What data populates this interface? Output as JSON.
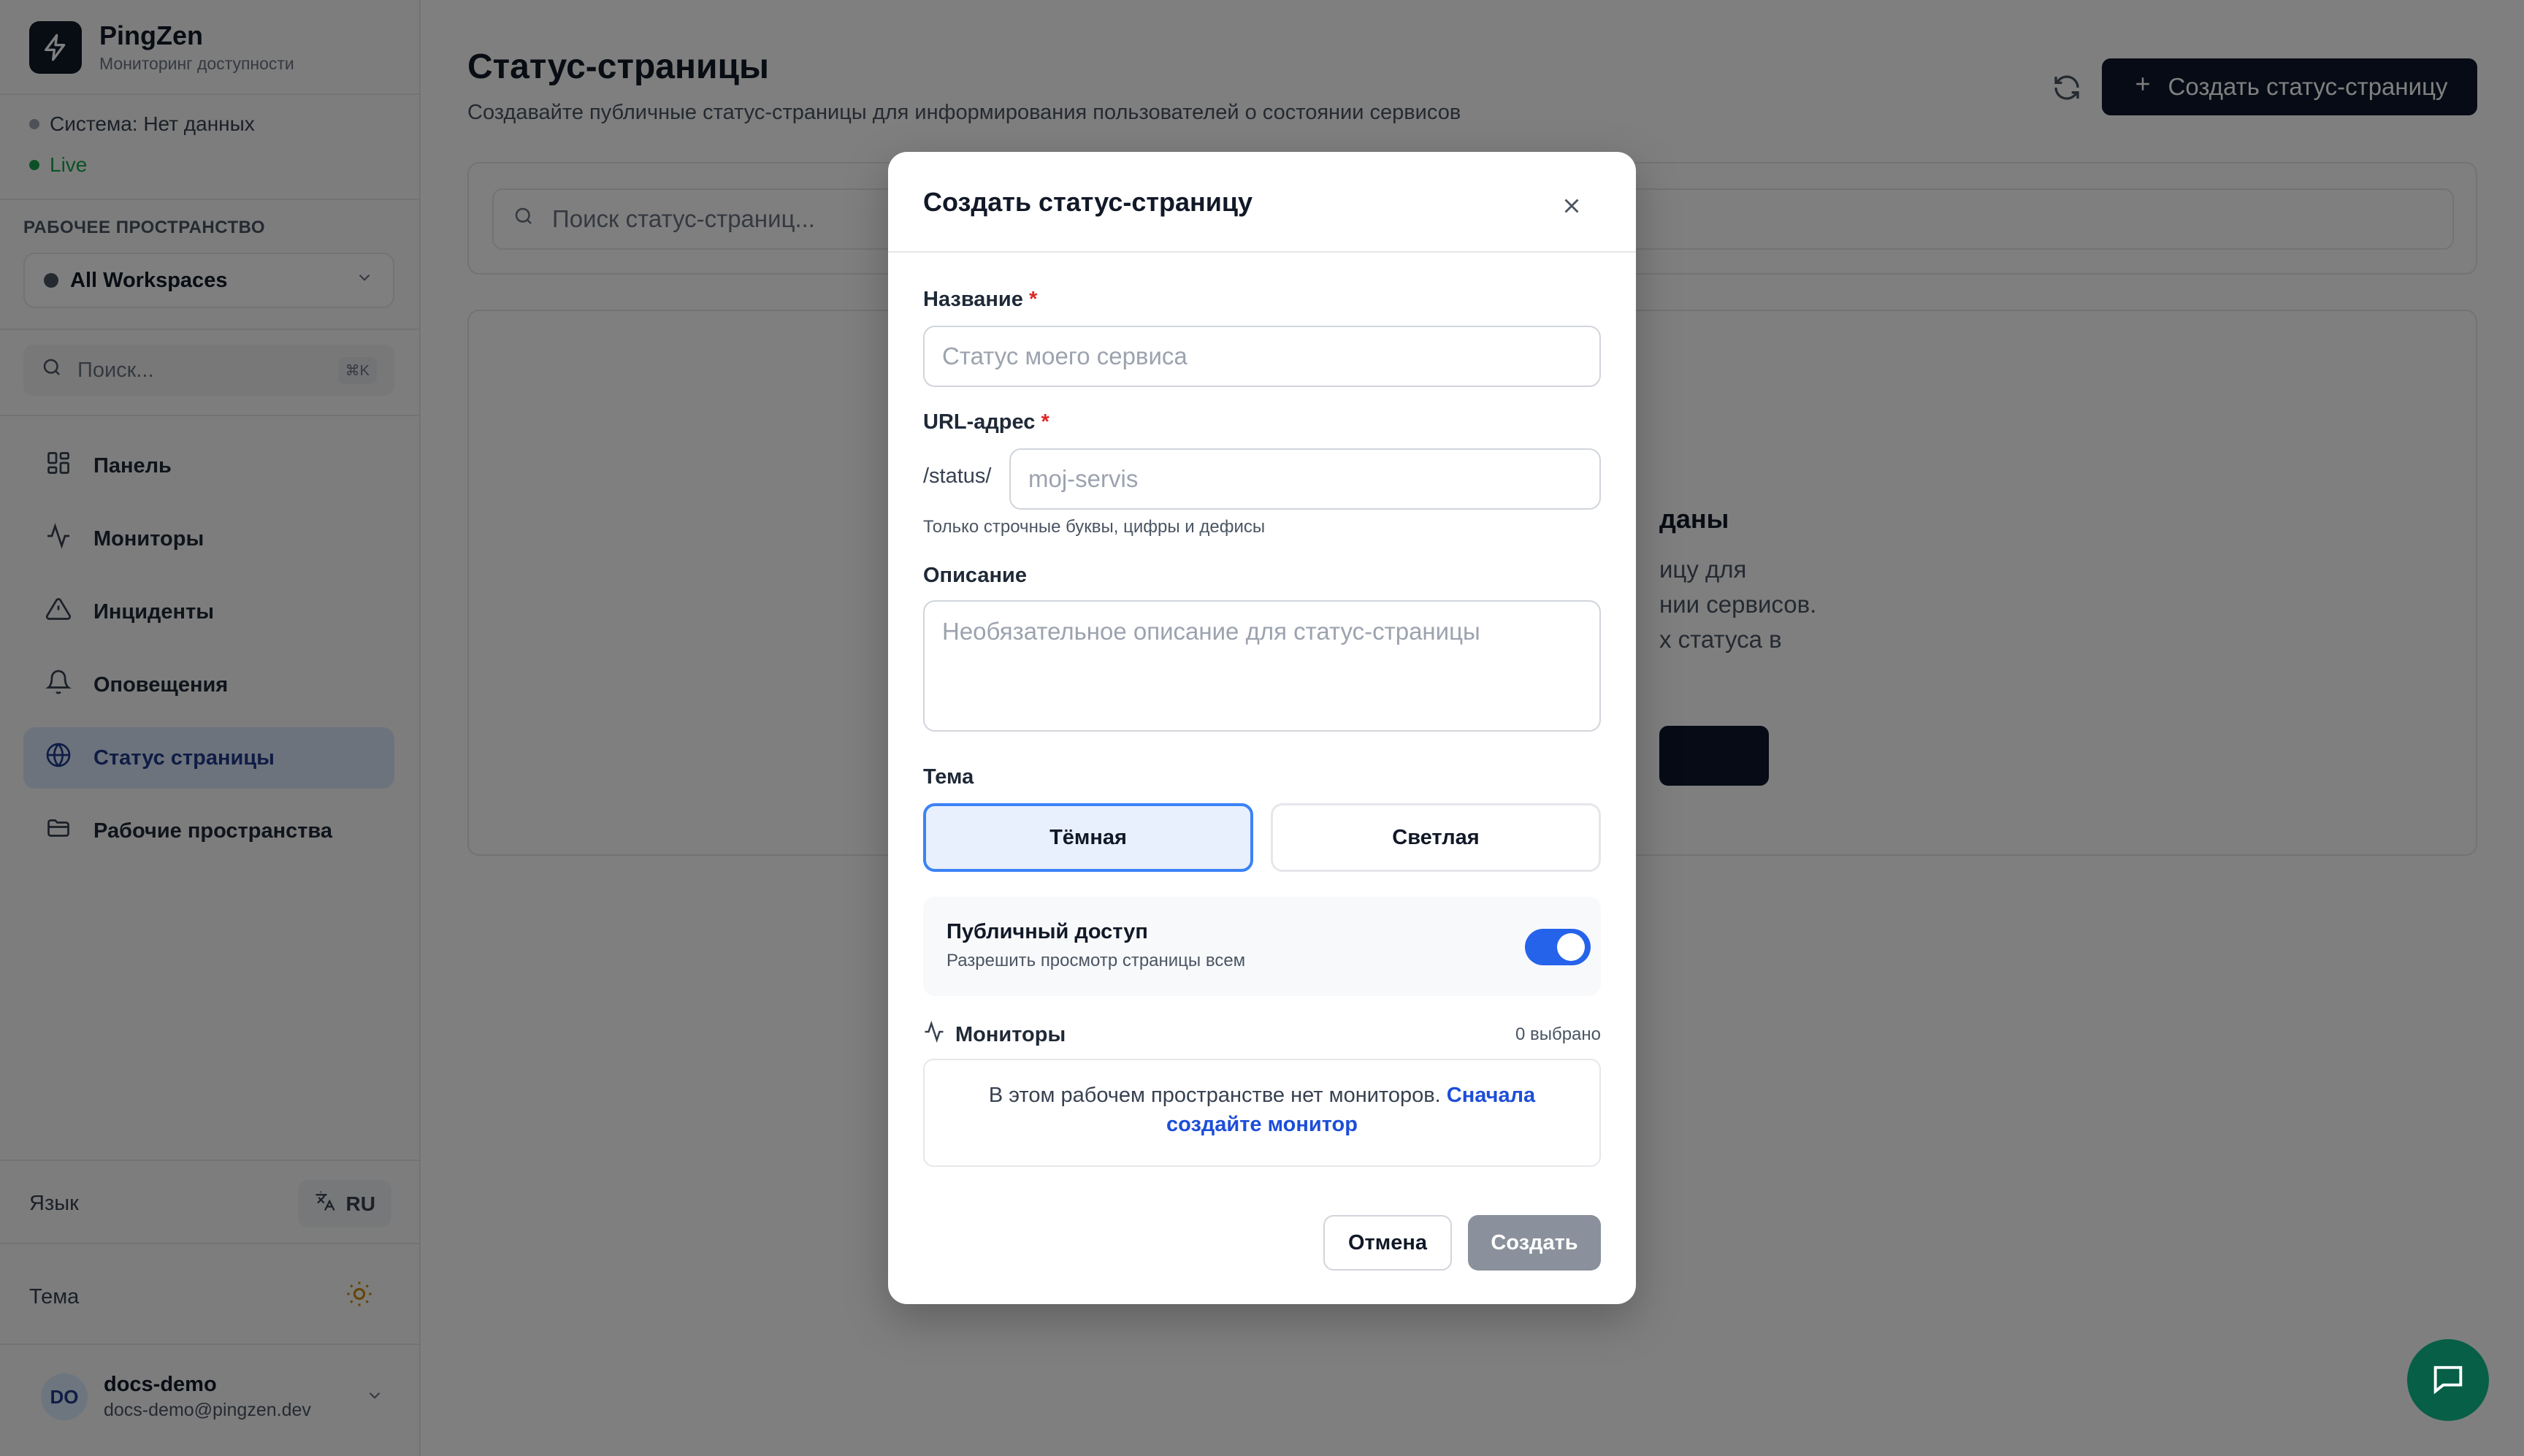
{
  "sidebar": {
    "brand_name": "PingZen",
    "brand_subtitle": "Мониторинг доступности",
    "system_status": "Система: Нет данных",
    "live_label": "Live",
    "workspace_heading": "РАБОЧЕЕ ПРОСТРАНСТВО",
    "workspace_selected": "All Workspaces",
    "search_placeholder": "Поиск...",
    "search_shortcut": "⌘K",
    "nav": [
      {
        "label": "Панель",
        "icon": "dashboard-icon"
      },
      {
        "label": "Мониторы",
        "icon": "activity-icon"
      },
      {
        "label": "Инциденты",
        "icon": "alert-triangle-icon"
      },
      {
        "label": "Оповещения",
        "icon": "bell-icon"
      },
      {
        "label": "Статус страницы",
        "icon": "globe-icon",
        "active": true
      },
      {
        "label": "Рабочие пространства",
        "icon": "folder-icon"
      }
    ],
    "language_label": "Язык",
    "language_value": "RU",
    "theme_label": "Тема",
    "user": {
      "initials": "DO",
      "name": "docs-demo",
      "email": "docs-demo@pingzen.dev"
    }
  },
  "main": {
    "title": "Статус-страницы",
    "subtitle": "Создавайте публичные статус-страницы для информирования пользователей о состоянии сервисов",
    "create_button": "Создать статус-страницу",
    "search_placeholder": "Поиск статус-страниц...",
    "empty_title_fragment": "даны",
    "empty_desc_fragment": "ицу для\nнии сервисов.\nх статуса в"
  },
  "modal": {
    "title": "Создать статус-страницу",
    "name_label": "Название",
    "name_placeholder": "Статус моего сервиса",
    "url_label": "URL-адрес",
    "url_prefix": "/status/",
    "url_placeholder": "moj-servis",
    "url_hint": "Только строчные буквы, цифры и дефисы",
    "description_label": "Описание",
    "description_placeholder": "Необязательное описание для статус-страницы",
    "theme_label": "Тема",
    "theme_dark": "Тёмная",
    "theme_light": "Светлая",
    "theme_selected": "dark",
    "public_title": "Публичный доступ",
    "public_subtitle": "Разрешить просмотр страницы всем",
    "public_enabled": true,
    "monitors_label": "Мониторы",
    "monitors_count": "0 выбрано",
    "monitors_empty_text": "В этом рабочем пространстве нет мониторов.",
    "monitors_empty_link": "Сначала создайте монитор",
    "cancel": "Отмена",
    "create": "Создать"
  },
  "colors": {
    "accent": "#2563eb",
    "primary_button": "#0f172a",
    "status_gray": "#6b7280",
    "live_green": "#16a34a",
    "chat_fab": "#065f46"
  }
}
